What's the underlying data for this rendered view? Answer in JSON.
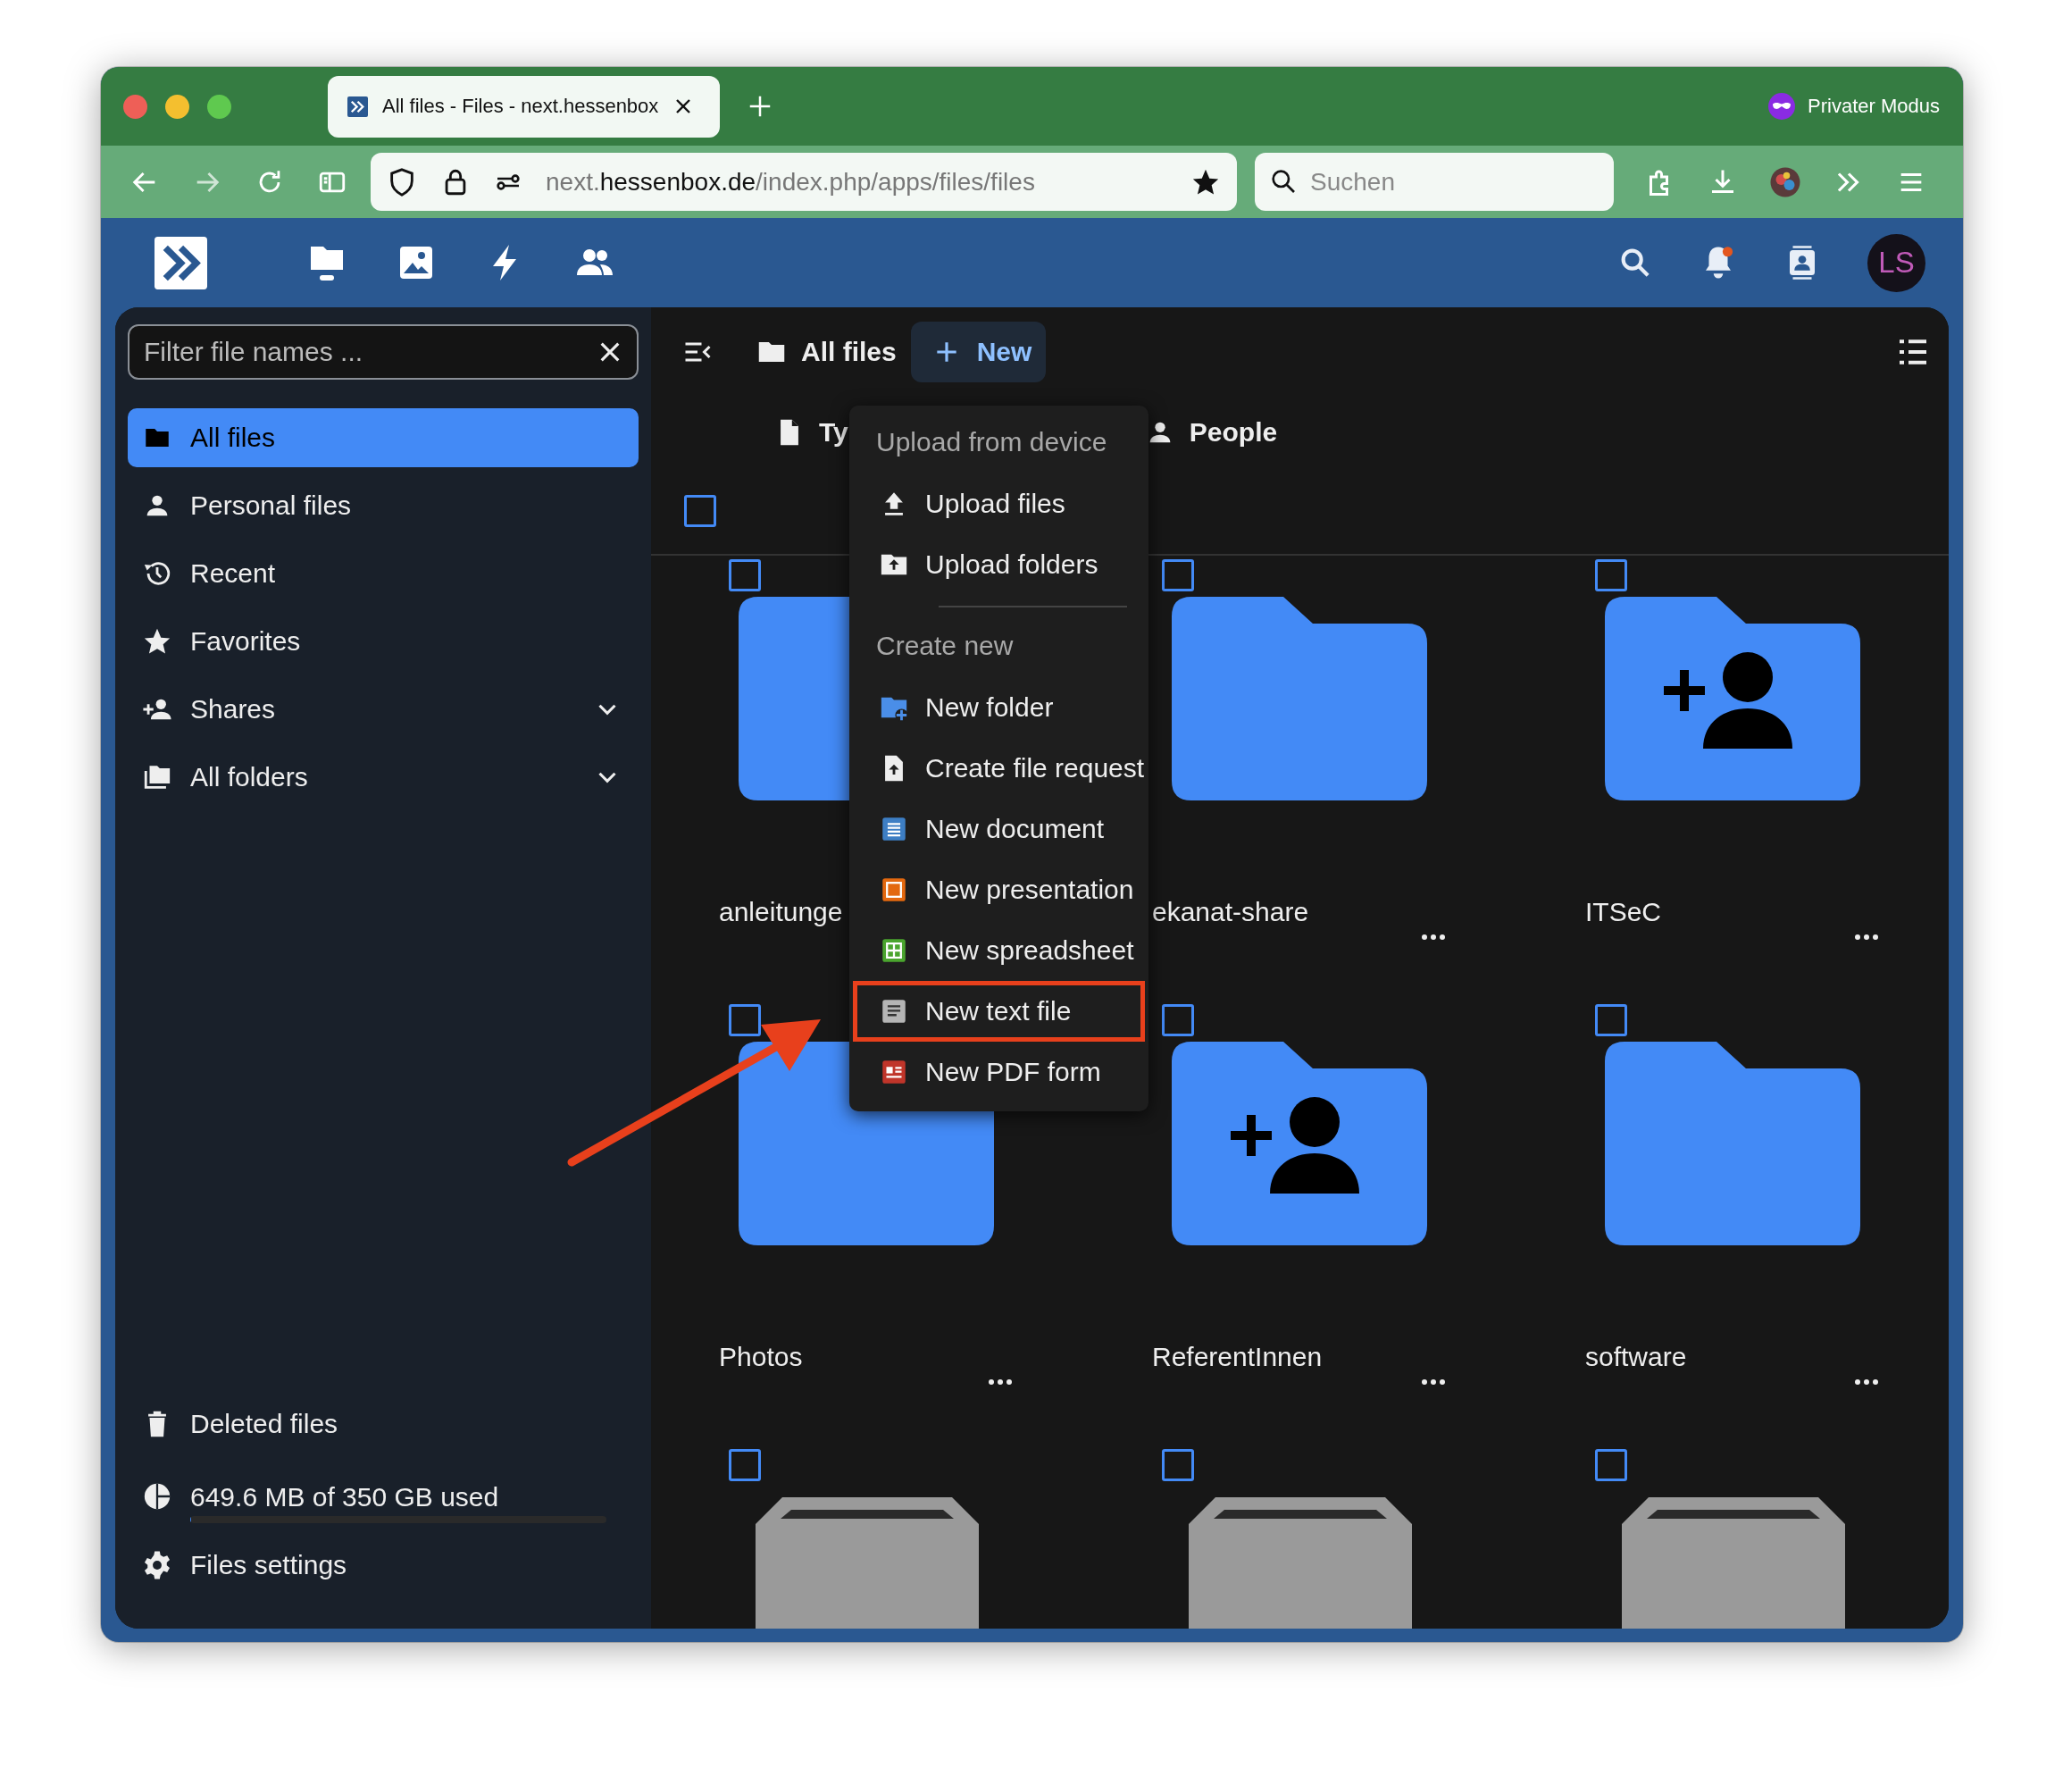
{
  "browser": {
    "tab_title": "All files - Files - next.hessenbox",
    "private_label": "Privater Modus",
    "url": {
      "subdomain": "next.",
      "domain": "hessenbox.de",
      "path": "/index.php/apps/files/files"
    },
    "bookmarked": true,
    "search_placeholder": "Suchen"
  },
  "header": {
    "avatar_initials": "LS",
    "notification_badge": true
  },
  "sidebar": {
    "filter_placeholder": "Filter file names ...",
    "items": [
      {
        "label": "All files",
        "selected": true
      },
      {
        "label": "Personal files",
        "selected": false
      },
      {
        "label": "Recent",
        "selected": false
      },
      {
        "label": "Favorites",
        "selected": false
      },
      {
        "label": "Shares",
        "selected": false,
        "expanded": false
      },
      {
        "label": "All folders",
        "selected": false,
        "expanded": false
      }
    ],
    "footer": [
      {
        "kind": "link",
        "label": "Deleted files"
      },
      {
        "kind": "quota",
        "label": "649.6 MB of 350 GB used",
        "level": 0.002
      },
      {
        "kind": "link",
        "label": "Files settings"
      }
    ]
  },
  "main": {
    "breadcrumb": "All files",
    "new_button": "New",
    "select_all": {
      "selected": false
    },
    "filters": [
      {
        "label": "Ty"
      },
      {
        "label": "People"
      }
    ],
    "items": [
      {
        "name": "anleitunge",
        "kind": "folder",
        "selected": false
      },
      {
        "name": "ekanat-share",
        "kind": "folder",
        "selected": false
      },
      {
        "name": "ITSeC",
        "kind": "shared",
        "selected": false
      },
      {
        "name": "Photos",
        "kind": "folder",
        "selected": false
      },
      {
        "name": "ReferentInnen",
        "kind": "shared",
        "selected": false
      },
      {
        "name": "software",
        "kind": "folder",
        "selected": false
      },
      {
        "kind": "storage",
        "selected": false
      },
      {
        "kind": "storage",
        "selected": false
      },
      {
        "kind": "storage",
        "selected": false
      }
    ],
    "new_menu": {
      "sections": [
        {
          "heading": "Upload from device",
          "items": [
            {
              "label": "Upload files",
              "highlighted": false
            },
            {
              "label": "Upload folders",
              "highlighted": false
            }
          ]
        },
        {
          "heading": "Create new",
          "items": [
            {
              "label": "New folder",
              "highlighted": false
            },
            {
              "label": "Create file request",
              "highlighted": false
            },
            {
              "label": "New document",
              "highlighted": false
            },
            {
              "label": "New presentation",
              "highlighted": false
            },
            {
              "label": "New spreadsheet",
              "highlighted": false
            },
            {
              "label": "New text file",
              "highlighted": true
            },
            {
              "label": "New PDF form",
              "highlighted": false
            }
          ]
        }
      ]
    }
  }
}
